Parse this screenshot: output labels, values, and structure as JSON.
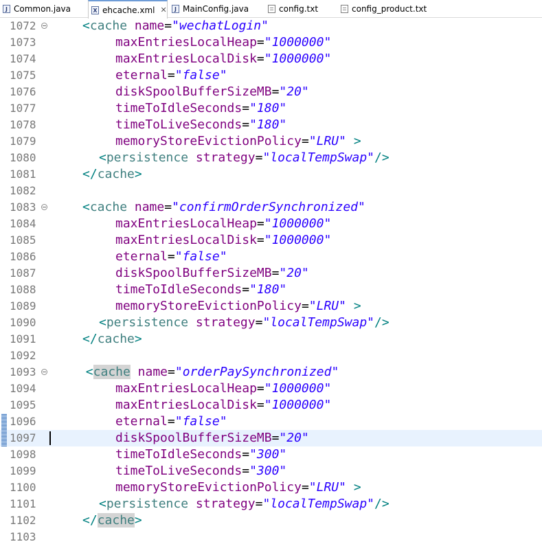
{
  "tabs": [
    {
      "label": "Common.java",
      "icon": "java-file-icon",
      "active": false
    },
    {
      "label": "ehcache.xml",
      "icon": "xml-file-icon",
      "active": true,
      "close": "✕"
    },
    {
      "label": "MainConfig.java",
      "icon": "java-file-icon",
      "active": false
    },
    {
      "label": "config.txt",
      "icon": "text-file-icon",
      "active": false
    },
    {
      "label": "config_product.txt",
      "icon": "text-file-icon",
      "active": false
    }
  ],
  "editor": {
    "current_line": "1097",
    "lines": [
      {
        "num": "1072",
        "fold": true,
        "indent": 2,
        "tokens": [
          [
            "br",
            "<"
          ],
          [
            "tag",
            "cache"
          ],
          [
            "sp",
            " "
          ],
          [
            "attr",
            "name"
          ],
          [
            "eq",
            "="
          ],
          [
            "val",
            "\"wechatLogin\""
          ]
        ]
      },
      {
        "num": "1073",
        "indent": 4,
        "tokens": [
          [
            "attr",
            "maxEntriesLocalHeap"
          ],
          [
            "eq",
            "="
          ],
          [
            "val",
            "\"1000000\""
          ]
        ]
      },
      {
        "num": "1074",
        "indent": 4,
        "tokens": [
          [
            "attr",
            "maxEntriesLocalDisk"
          ],
          [
            "eq",
            "="
          ],
          [
            "val",
            "\"1000000\""
          ]
        ]
      },
      {
        "num": "1075",
        "indent": 4,
        "tokens": [
          [
            "attr",
            "eternal"
          ],
          [
            "eq",
            "="
          ],
          [
            "val",
            "\"false\""
          ]
        ]
      },
      {
        "num": "1076",
        "indent": 4,
        "tokens": [
          [
            "attr",
            "diskSpoolBufferSizeMB"
          ],
          [
            "eq",
            "="
          ],
          [
            "val",
            "\"20\""
          ]
        ]
      },
      {
        "num": "1077",
        "indent": 4,
        "tokens": [
          [
            "attr",
            "timeToIdleSeconds"
          ],
          [
            "eq",
            "="
          ],
          [
            "val",
            "\"180\""
          ]
        ]
      },
      {
        "num": "1078",
        "indent": 4,
        "tokens": [
          [
            "attr",
            "timeToLiveSeconds"
          ],
          [
            "eq",
            "="
          ],
          [
            "val",
            "\"180\""
          ]
        ]
      },
      {
        "num": "1079",
        "indent": 4,
        "tokens": [
          [
            "attr",
            "memoryStoreEvictionPolicy"
          ],
          [
            "eq",
            "="
          ],
          [
            "val",
            "\"LRU\""
          ],
          [
            "sp",
            " "
          ],
          [
            "br",
            ">"
          ]
        ]
      },
      {
        "num": "1080",
        "indent": 3,
        "tokens": [
          [
            "br",
            "<"
          ],
          [
            "tag",
            "persistence"
          ],
          [
            "sp",
            " "
          ],
          [
            "attr",
            "strategy"
          ],
          [
            "eq",
            "="
          ],
          [
            "val",
            "\"localTempSwap\""
          ],
          [
            "br",
            "/>"
          ]
        ]
      },
      {
        "num": "1081",
        "indent": 2,
        "tokens": [
          [
            "br",
            "</"
          ],
          [
            "tag",
            "cache"
          ],
          [
            "br",
            ">"
          ]
        ]
      },
      {
        "num": "1082",
        "indent": 0,
        "tokens": []
      },
      {
        "num": "1083",
        "fold": true,
        "indent": 2,
        "tokens": [
          [
            "br",
            "<"
          ],
          [
            "tag",
            "cache"
          ],
          [
            "sp",
            " "
          ],
          [
            "attr",
            "name"
          ],
          [
            "eq",
            "="
          ],
          [
            "val",
            "\"confirmOrderSynchronized\""
          ]
        ]
      },
      {
        "num": "1084",
        "indent": 4,
        "tokens": [
          [
            "attr",
            "maxEntriesLocalHeap"
          ],
          [
            "eq",
            "="
          ],
          [
            "val",
            "\"1000000\""
          ]
        ]
      },
      {
        "num": "1085",
        "indent": 4,
        "tokens": [
          [
            "attr",
            "maxEntriesLocalDisk"
          ],
          [
            "eq",
            "="
          ],
          [
            "val",
            "\"1000000\""
          ]
        ]
      },
      {
        "num": "1086",
        "indent": 4,
        "tokens": [
          [
            "attr",
            "eternal"
          ],
          [
            "eq",
            "="
          ],
          [
            "val",
            "\"false\""
          ]
        ]
      },
      {
        "num": "1087",
        "indent": 4,
        "tokens": [
          [
            "attr",
            "diskSpoolBufferSizeMB"
          ],
          [
            "eq",
            "="
          ],
          [
            "val",
            "\"20\""
          ]
        ]
      },
      {
        "num": "1088",
        "indent": 4,
        "tokens": [
          [
            "attr",
            "timeToIdleSeconds"
          ],
          [
            "eq",
            "="
          ],
          [
            "val",
            "\"180\""
          ]
        ]
      },
      {
        "num": "1089",
        "indent": 4,
        "tokens": [
          [
            "attr",
            "memoryStoreEvictionPolicy"
          ],
          [
            "eq",
            "="
          ],
          [
            "val",
            "\"LRU\""
          ],
          [
            "sp",
            " "
          ],
          [
            "br",
            ">"
          ]
        ]
      },
      {
        "num": "1090",
        "indent": 3,
        "tokens": [
          [
            "br",
            "<"
          ],
          [
            "tag",
            "persistence"
          ],
          [
            "sp",
            " "
          ],
          [
            "attr",
            "strategy"
          ],
          [
            "eq",
            "="
          ],
          [
            "val",
            "\"localTempSwap\""
          ],
          [
            "br",
            "/>"
          ]
        ]
      },
      {
        "num": "1091",
        "indent": 2,
        "tokens": [
          [
            "br",
            "</"
          ],
          [
            "tag",
            "cache"
          ],
          [
            "br",
            ">"
          ]
        ]
      },
      {
        "num": "1092",
        "indent": 0,
        "tokens": []
      },
      {
        "num": "1093",
        "fold": true,
        "indent": 2.2,
        "tokens": [
          [
            "br",
            "<"
          ],
          [
            "taghl",
            "cache"
          ],
          [
            "sp",
            " "
          ],
          [
            "attr",
            "name"
          ],
          [
            "eq",
            "="
          ],
          [
            "val",
            "\"orderPaySynchronized\""
          ]
        ]
      },
      {
        "num": "1094",
        "indent": 4,
        "tokens": [
          [
            "attr",
            "maxEntriesLocalHeap"
          ],
          [
            "eq",
            "="
          ],
          [
            "val",
            "\"1000000\""
          ]
        ]
      },
      {
        "num": "1095",
        "indent": 4,
        "tokens": [
          [
            "attr",
            "maxEntriesLocalDisk"
          ],
          [
            "eq",
            "="
          ],
          [
            "val",
            "\"1000000\""
          ]
        ]
      },
      {
        "num": "1096",
        "indent": 4,
        "marker": true,
        "tokens": [
          [
            "attr",
            "eternal"
          ],
          [
            "eq",
            "="
          ],
          [
            "val",
            "\"false\""
          ]
        ]
      },
      {
        "num": "1097",
        "indent": 4,
        "marker": true,
        "tokens": [
          [
            "attr",
            "diskSpoolBufferSizeMB"
          ],
          [
            "eq",
            "="
          ],
          [
            "val",
            "\"20\""
          ]
        ]
      },
      {
        "num": "1098",
        "indent": 4,
        "tokens": [
          [
            "attr",
            "timeToIdleSeconds"
          ],
          [
            "eq",
            "="
          ],
          [
            "val",
            "\"300\""
          ]
        ]
      },
      {
        "num": "1099",
        "indent": 4,
        "tokens": [
          [
            "attr",
            "timeToLiveSeconds"
          ],
          [
            "eq",
            "="
          ],
          [
            "val",
            "\"300\""
          ]
        ]
      },
      {
        "num": "1100",
        "indent": 4,
        "tokens": [
          [
            "attr",
            "memoryStoreEvictionPolicy"
          ],
          [
            "eq",
            "="
          ],
          [
            "val",
            "\"LRU\""
          ],
          [
            "sp",
            " "
          ],
          [
            "br",
            ">"
          ]
        ]
      },
      {
        "num": "1101",
        "indent": 3,
        "tokens": [
          [
            "br",
            "<"
          ],
          [
            "tag",
            "persistence"
          ],
          [
            "sp",
            " "
          ],
          [
            "attr",
            "strategy"
          ],
          [
            "eq",
            "="
          ],
          [
            "val",
            "\"localTempSwap\""
          ],
          [
            "br",
            "/>"
          ]
        ]
      },
      {
        "num": "1102",
        "indent": 2,
        "tokens": [
          [
            "br",
            "</"
          ],
          [
            "taghl",
            "cache"
          ],
          [
            "br",
            ">"
          ]
        ]
      },
      {
        "num": "1103",
        "indent": 0,
        "tokens": []
      }
    ]
  }
}
